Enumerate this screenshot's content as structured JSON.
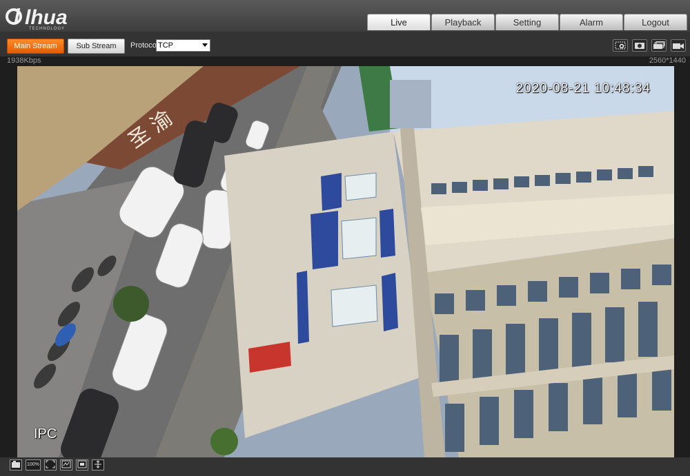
{
  "brand": {
    "logo_text": "alhua",
    "logo_sub": "TECHNOLOGY"
  },
  "nav": {
    "tabs": [
      {
        "label": "Live",
        "active": true
      },
      {
        "label": "Playback"
      },
      {
        "label": "Setting"
      },
      {
        "label": "Alarm"
      },
      {
        "label": "Logout"
      }
    ]
  },
  "toolbar": {
    "main_stream_label": "Main Stream",
    "sub_stream_label": "Sub Stream",
    "protocol_label": "Protocol",
    "protocol_value": "TCP",
    "icons": [
      "zoom-region-icon",
      "snapshot-icon",
      "triple-snapshot-icon",
      "record-icon"
    ]
  },
  "status": {
    "bitrate": "1938Kbps",
    "resolution": "2560*1440"
  },
  "video": {
    "osd_timestamp": "2020-08-21 10:48:34",
    "osd_channel": "IPC"
  },
  "bottombar": {
    "labels": [
      "",
      "100%",
      "",
      "",
      "",
      ""
    ],
    "icons": [
      "window-split-icon",
      "zoom-100-icon",
      "fit-window-icon",
      "aspect-ratio-icon",
      "fullscreen-icon",
      "ptz-icon"
    ]
  },
  "colors": {
    "accent": "#f07012",
    "header": "#4a4a4a",
    "toolbar": "#333333"
  }
}
